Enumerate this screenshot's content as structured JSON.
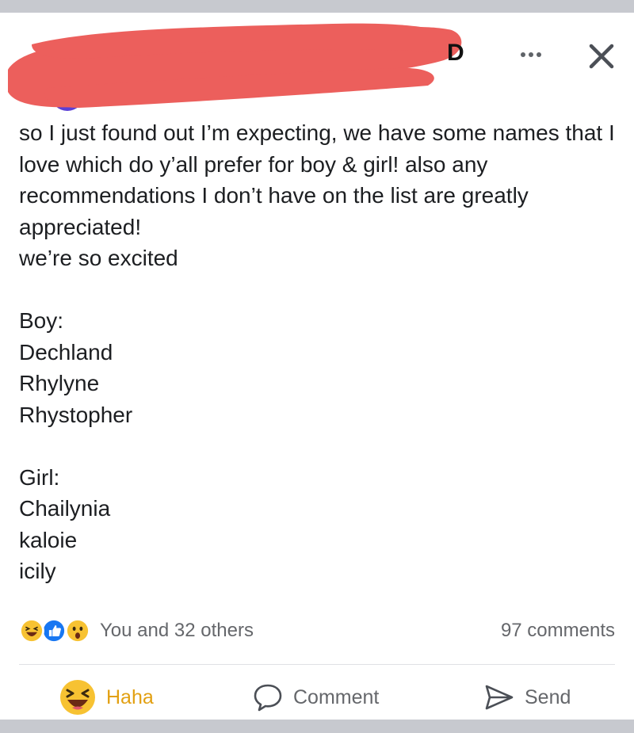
{
  "header": {
    "visible_name_fragment": "D",
    "more_label": "More options",
    "close_label": "Close"
  },
  "post": {
    "text": "so I just found out I’m expecting, we have some names that I love which do y’all prefer for boy & girl! also any recommendations I don’t have on the list are greatly appreciated!\nwe’re so excited\n\nBoy:\nDechland\nRhylyne\nRhystopher\n\nGirl:\nChailynia\nkaloie\nicily"
  },
  "reactions": {
    "summary": "You and 32 others",
    "comments": "97 comments",
    "icons": [
      "haha-icon",
      "like-icon",
      "wow-icon"
    ]
  },
  "actions": {
    "haha": "Haha",
    "comment": "Comment",
    "send": "Send"
  },
  "colors": {
    "redaction": "#ec5f5c",
    "haha_active": "#e2a012",
    "like_blue": "#1877f2",
    "muted_text": "#65676b"
  }
}
